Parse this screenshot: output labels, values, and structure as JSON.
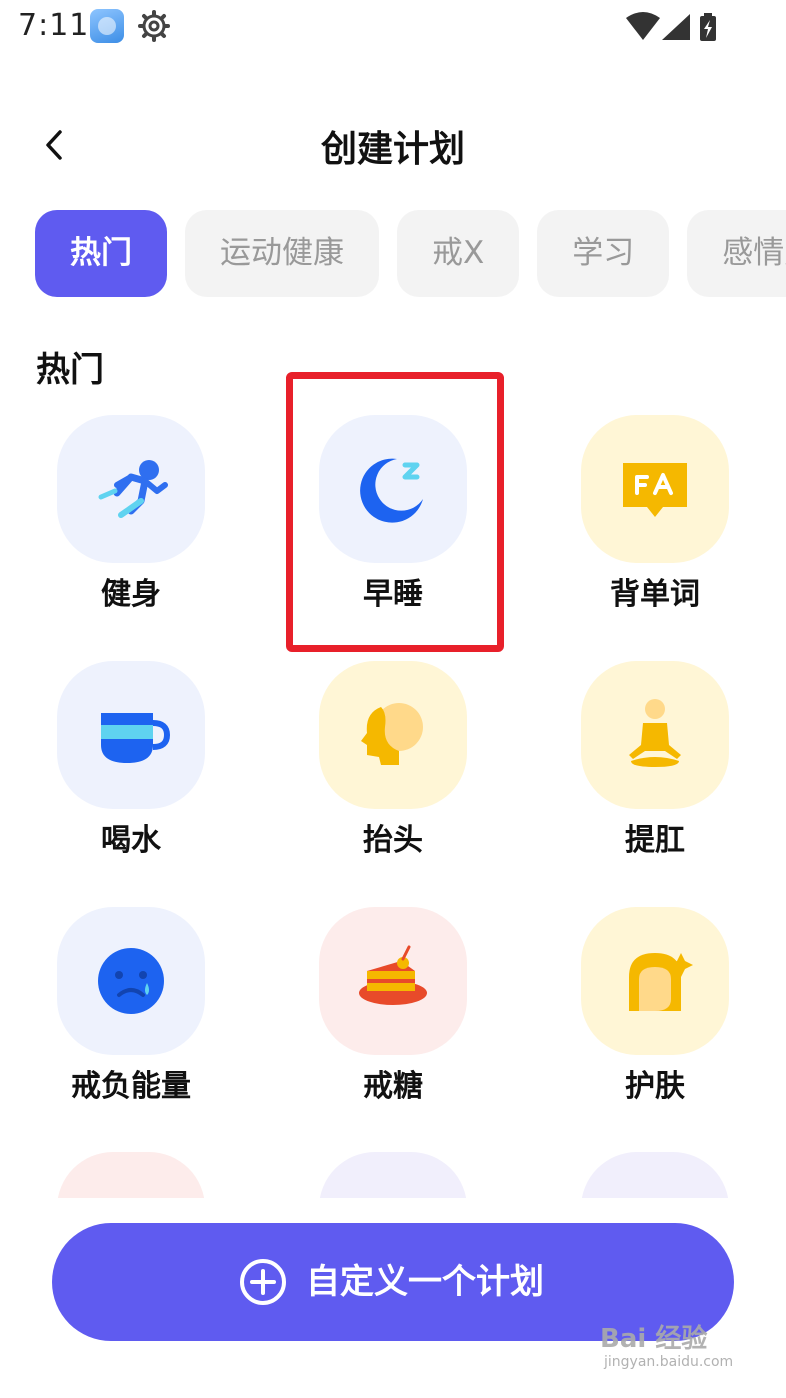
{
  "status_bar": {
    "time": "7:11",
    "icons": [
      "app-icon",
      "gear-icon",
      "wifi-icon",
      "signal-icon",
      "battery-charging-icon"
    ]
  },
  "header": {
    "title": "创建计划",
    "back_icon": "chevron-left-icon"
  },
  "tabs": [
    {
      "label": "热门",
      "active": true
    },
    {
      "label": "运动健康",
      "active": false
    },
    {
      "label": "戒X",
      "active": false
    },
    {
      "label": "学习",
      "active": false
    },
    {
      "label": "感情建",
      "active": false
    }
  ],
  "section": {
    "title": "热门",
    "items": [
      {
        "label": "健身",
        "icon": "running-icon"
      },
      {
        "label": "早睡",
        "icon": "moon-sleep-icon"
      },
      {
        "label": "背单词",
        "icon": "vocabulary-icon"
      },
      {
        "label": "喝水",
        "icon": "cup-icon"
      },
      {
        "label": "抬头",
        "icon": "head-profile-icon"
      },
      {
        "label": "提肛",
        "icon": "meditation-icon"
      },
      {
        "label": "戒负能量",
        "icon": "sad-face-icon"
      },
      {
        "label": "戒糖",
        "icon": "cake-icon"
      },
      {
        "label": "护肤",
        "icon": "skincare-face-icon"
      }
    ]
  },
  "custom_plan_button": {
    "label": "自定义一个计划",
    "icon": "plus-circle-icon"
  },
  "watermark": {
    "text": "Bai 经验",
    "sub": "jingyan.baidu.com"
  },
  "colors": {
    "accent": "#5f5bf0",
    "highlight": "#e8202a",
    "blue_tile": "#eef2fd",
    "yellow_tile": "#fff6d6",
    "pink_tile": "#fdeceb"
  }
}
